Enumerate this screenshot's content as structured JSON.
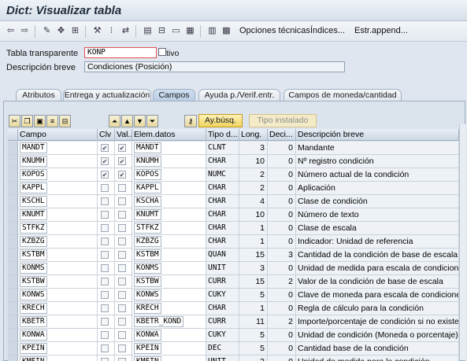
{
  "window": {
    "title": "Dict: Visualizar tabla"
  },
  "toolbar": {
    "icons": [
      "back-arrow-icon",
      "forward-arrow-icon",
      "edit-pencil-icon",
      "other-object-icon",
      "hierarchy-icon",
      "activate-icon",
      "where-used-icon",
      "navigation-icon",
      "display-object-list-icon",
      "tree-icon",
      "info-icon",
      "table-icon",
      "layout-icon"
    ],
    "items": [
      "Opciones técnicas",
      "Índices...",
      "Estr.append..."
    ]
  },
  "form": {
    "table_label": "Tabla transparente",
    "table_value": "KONP",
    "status_value": "Activo",
    "desc_label": "Descripción breve",
    "desc_value": "Condiciones (Posición)"
  },
  "tabs": [
    {
      "label": "Atributos",
      "active": false
    },
    {
      "label": "Entrega y actualización",
      "active": false
    },
    {
      "label": "Campos",
      "active": true
    },
    {
      "label": "Ayuda p./Verif.entr.",
      "active": false
    },
    {
      "label": "Campos de moneda/cantidad",
      "active": false
    }
  ],
  "panel": {
    "search_label": "Ay.búsq.",
    "builtin_label": "Tipo instalado",
    "tools_left": [
      "cut-icon",
      "copy-icon",
      "paste-icon",
      "insert-row-icon",
      "delete-row-icon"
    ],
    "tools_mid": [
      "first-page-icon",
      "prev-page-icon",
      "next-page-icon",
      "last-page-icon"
    ],
    "key_icon": "key-icon"
  },
  "grid": {
    "headers": [
      "Campo",
      "Clv",
      "Val...",
      "Elem.datos",
      "Tipo d...",
      "Long.",
      "Deci...",
      "Descripción breve"
    ],
    "rows": [
      {
        "campo": "MANDT",
        "clv": true,
        "val": true,
        "elem": "MANDT",
        "tipo": "CLNT",
        "long": "3",
        "deci": "0",
        "desc": "Mandante"
      },
      {
        "campo": "KNUMH",
        "clv": true,
        "val": true,
        "elem": "KNUMH",
        "tipo": "CHAR",
        "long": "10",
        "deci": "0",
        "desc": "Nº registro condición"
      },
      {
        "campo": "KOPOS",
        "clv": true,
        "val": true,
        "elem": "KOPOS",
        "tipo": "NUMC",
        "long": "2",
        "deci": "0",
        "desc": "Número actual de la condición"
      },
      {
        "campo": "KAPPL",
        "clv": false,
        "val": false,
        "elem": "KAPPL",
        "tipo": "CHAR",
        "long": "2",
        "deci": "0",
        "desc": "Aplicación"
      },
      {
        "campo": "KSCHL",
        "clv": false,
        "val": false,
        "elem": "KSCHA",
        "tipo": "CHAR",
        "long": "4",
        "deci": "0",
        "desc": "Clase de condición"
      },
      {
        "campo": "KNUMT",
        "clv": false,
        "val": false,
        "elem": "KNUMT",
        "tipo": "CHAR",
        "long": "10",
        "deci": "0",
        "desc": "Número de texto"
      },
      {
        "campo": "STFKZ",
        "clv": false,
        "val": false,
        "elem": "STFKZ",
        "tipo": "CHAR",
        "long": "1",
        "deci": "0",
        "desc": "Clase de escala"
      },
      {
        "campo": "KZBZG",
        "clv": false,
        "val": false,
        "elem": "KZBZG",
        "tipo": "CHAR",
        "long": "1",
        "deci": "0",
        "desc": "Indicador: Unidad de referencia"
      },
      {
        "campo": "KSTBM",
        "clv": false,
        "val": false,
        "elem": "KSTBM",
        "tipo": "QUAN",
        "long": "15",
        "deci": "3",
        "desc": "Cantidad de la condición de base de escala"
      },
      {
        "campo": "KONMS",
        "clv": false,
        "val": false,
        "elem": "KONMS",
        "tipo": "UNIT",
        "long": "3",
        "deci": "0",
        "desc": "Unidad de medida para escala de condiciones"
      },
      {
        "campo": "KSTBW",
        "clv": false,
        "val": false,
        "elem": "KSTBW",
        "tipo": "CURR",
        "long": "15",
        "deci": "2",
        "desc": "Valor de la condición de base de escala"
      },
      {
        "campo": "KONWS",
        "clv": false,
        "val": false,
        "elem": "KONWS",
        "tipo": "CUKY",
        "long": "5",
        "deci": "0",
        "desc": "Clave de moneda para escala de condiciones"
      },
      {
        "campo": "KRECH",
        "clv": false,
        "val": false,
        "elem": "KRECH",
        "tipo": "CHAR",
        "long": "1",
        "deci": "0",
        "desc": "Regla de cálculo para la condición"
      },
      {
        "campo": "KBETR",
        "clv": false,
        "val": false,
        "elem": "KBETR_KOND",
        "tipo": "CURR",
        "long": "11",
        "deci": "2",
        "desc": "Importe/porcentaje de condición si no existe escala"
      },
      {
        "campo": "KONWA",
        "clv": false,
        "val": false,
        "elem": "KONWA",
        "tipo": "CUKY",
        "long": "5",
        "deci": "0",
        "desc": "Unidad de condición (Moneda o porcentaje)"
      },
      {
        "campo": "KPEIN",
        "clv": false,
        "val": false,
        "elem": "KPEIN",
        "tipo": "DEC",
        "long": "5",
        "deci": "0",
        "desc": "Cantidad base de la condición"
      },
      {
        "campo": "KMEIN",
        "clv": false,
        "val": false,
        "elem": "KMEIN",
        "tipo": "UNIT",
        "long": "3",
        "deci": "0",
        "desc": "Unidad de medida para la condición"
      }
    ]
  }
}
